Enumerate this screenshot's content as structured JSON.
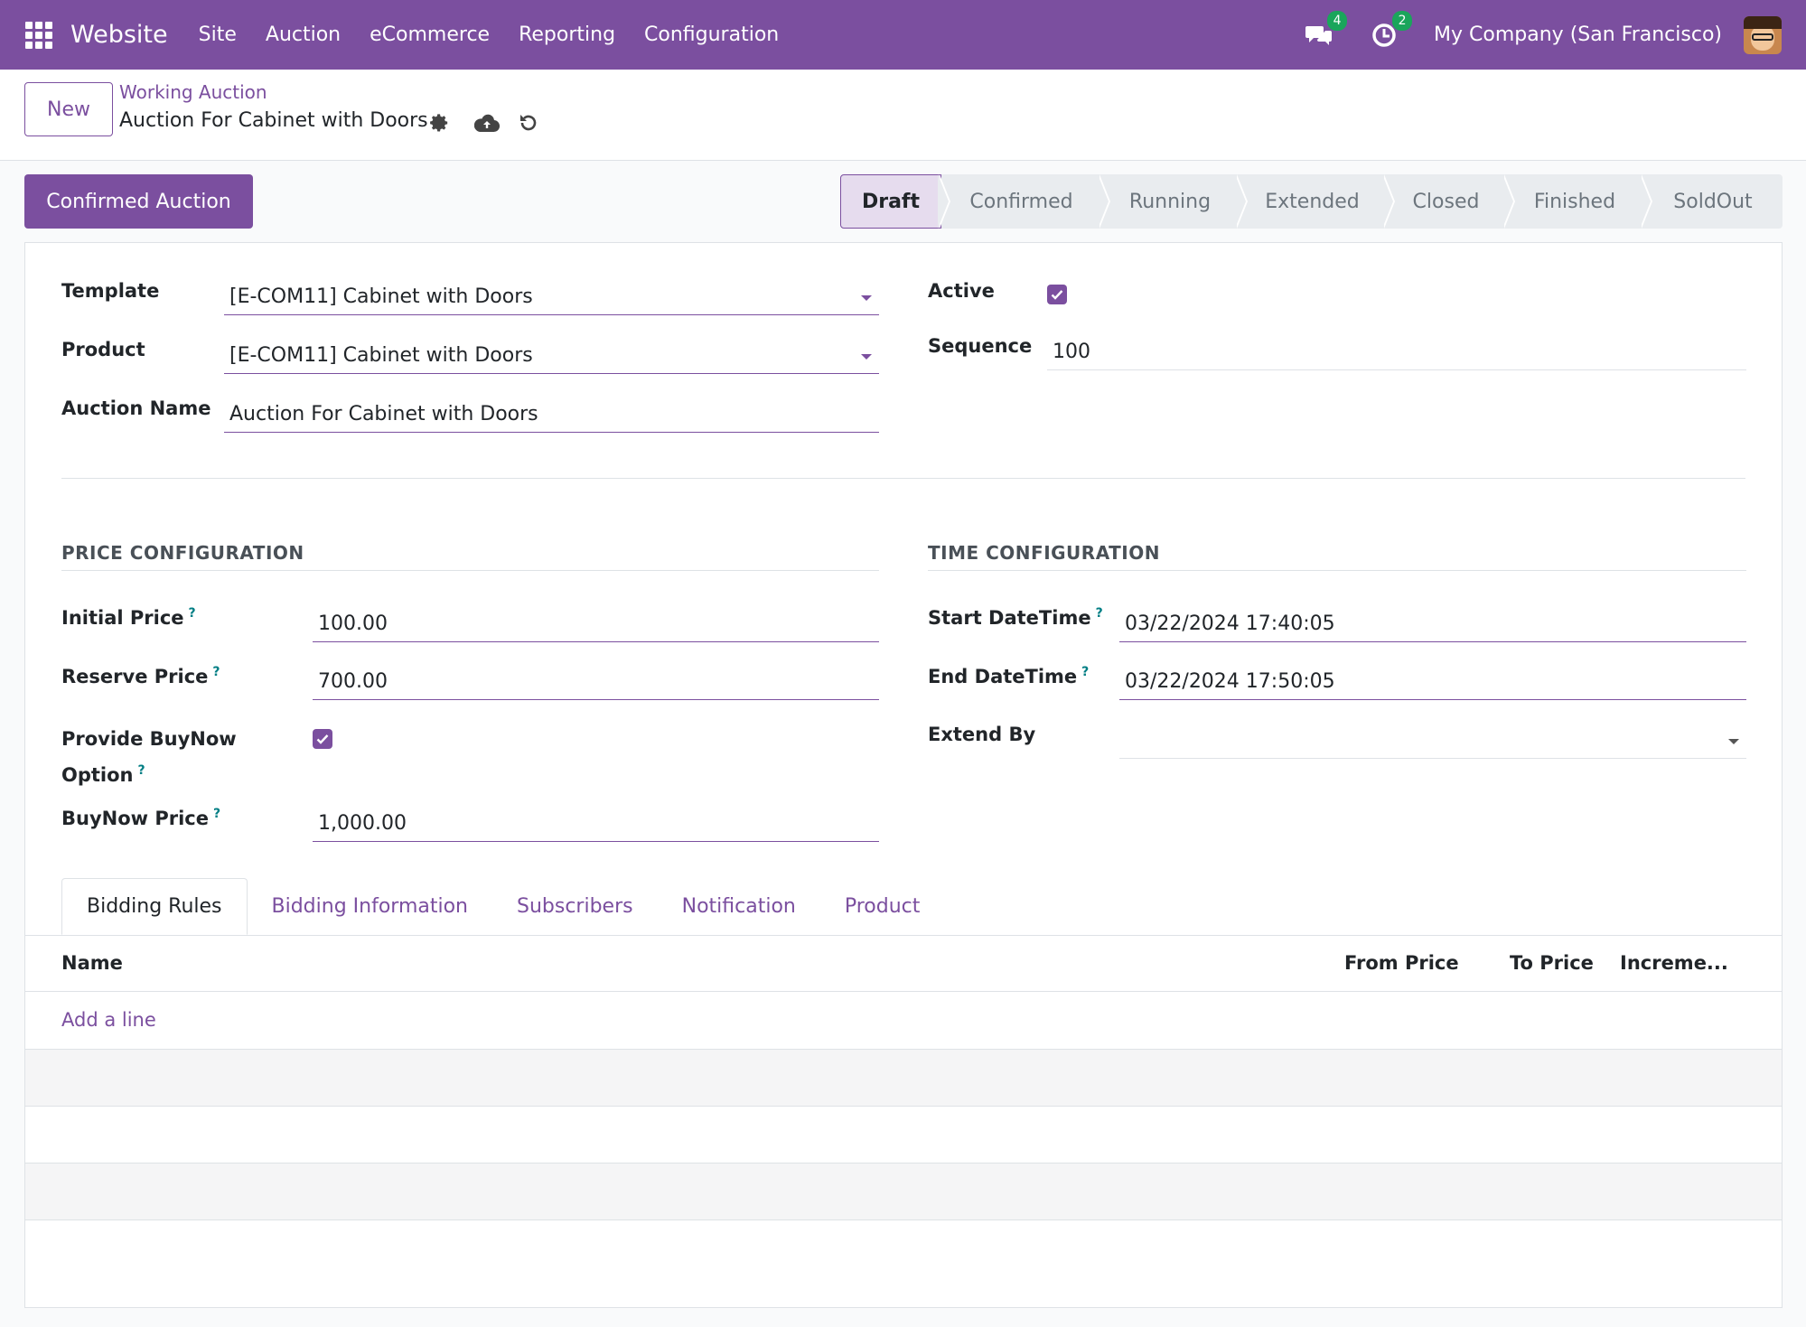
{
  "navbar": {
    "app_name": "Website",
    "menu": [
      "Site",
      "Auction",
      "eCommerce",
      "Reporting",
      "Configuration"
    ],
    "messages_count": "4",
    "activities_count": "2",
    "company": "My Company (San Francisco)",
    "bg_color": "#7b4f9f"
  },
  "control_panel": {
    "new_label": "New",
    "breadcrumb": "Working Auction",
    "record_title": "Auction For Cabinet with Doors"
  },
  "status": {
    "action_label": "Confirmed Auction",
    "stages": [
      "Draft",
      "Confirmed",
      "Running",
      "Extended",
      "Closed",
      "Finished",
      "SoldOut"
    ],
    "current": "Draft"
  },
  "form": {
    "template": {
      "label": "Template",
      "value": "[E-COM11] Cabinet with Doors"
    },
    "product": {
      "label": "Product",
      "value": "[E-COM11] Cabinet with Doors"
    },
    "auction_name": {
      "label": "Auction Name",
      "value": "Auction For Cabinet with Doors"
    },
    "active": {
      "label": "Active",
      "checked": true
    },
    "sequence": {
      "label": "Sequence",
      "value": "100"
    },
    "price_section": "PRICE CONFIGURATION",
    "time_section": "TIME CONFIGURATION",
    "initial_price": {
      "label": "Initial Price",
      "value": "100.00"
    },
    "reserve_price": {
      "label": "Reserve Price",
      "value": "700.00"
    },
    "buynow_option": {
      "label_line1": "Provide BuyNow",
      "label_line2": "Option",
      "checked": true
    },
    "buynow_price": {
      "label": "BuyNow Price",
      "value": "1,000.00"
    },
    "start_datetime": {
      "label": "Start DateTime",
      "value": "03/22/2024 17:40:05"
    },
    "end_datetime": {
      "label": "End DateTime",
      "value": "03/22/2024 17:50:05"
    },
    "extend_by": {
      "label": "Extend By",
      "value": ""
    },
    "help_marker": "?"
  },
  "tabs": [
    "Bidding Rules",
    "Bidding Information",
    "Subscribers",
    "Notification",
    "Product"
  ],
  "active_tab": "Bidding Rules",
  "table": {
    "columns": [
      "Name",
      "From Price",
      "To Price",
      "Increme..."
    ],
    "add_line": "Add a line"
  }
}
